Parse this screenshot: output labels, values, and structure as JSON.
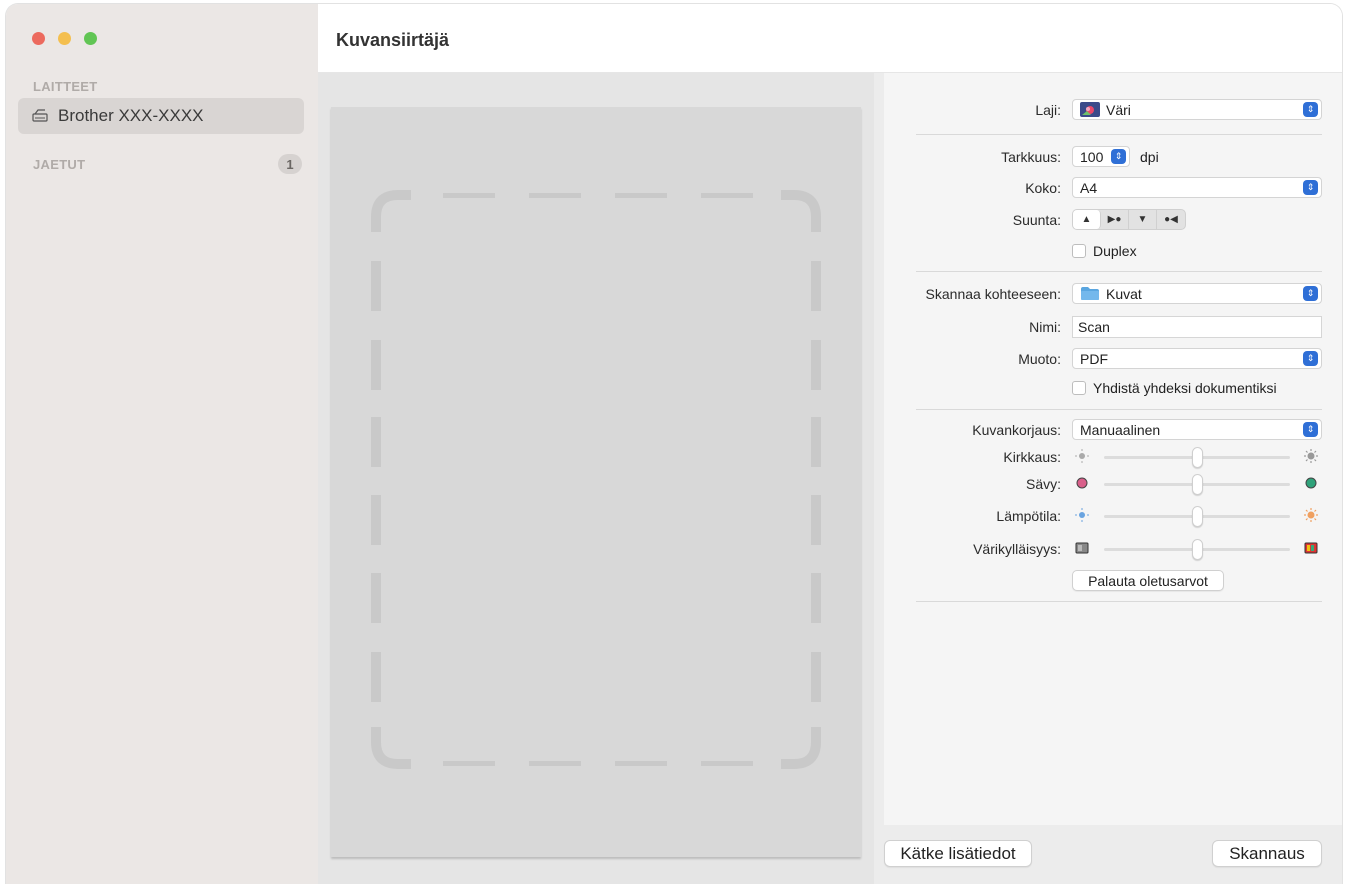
{
  "window": {
    "title": "Kuvansiirtäjä"
  },
  "traffic_lights": {
    "close": "#ec6a5e",
    "minimize": "#f4bf4f",
    "zoom": "#61c554"
  },
  "sidebar": {
    "devices_header": "LAITTEET",
    "device_name": "Brother XXX-XXXX",
    "device_icon": "scanner-icon",
    "shared_header": "JAETUT",
    "shared_count": "1"
  },
  "settings": {
    "kind": {
      "label": "Laji:",
      "value": "Väri",
      "icon": "color-photo-icon"
    },
    "resolution": {
      "label": "Tarkkuus:",
      "value": "100",
      "unit": "dpi"
    },
    "size": {
      "label": "Koko:",
      "value": "A4"
    },
    "orientation": {
      "label": "Suunta:",
      "icons": [
        "portrait-icon",
        "rotate-right-icon",
        "upside-down-icon",
        "rotate-left-icon"
      ]
    },
    "duplex": {
      "label": "Duplex",
      "checked": false
    },
    "scan_to": {
      "label": "Skannaa kohteeseen:",
      "value": "Kuvat",
      "icon": "folder-icon"
    },
    "name": {
      "label": "Nimi:",
      "value": "Scan"
    },
    "format": {
      "label": "Muoto:",
      "value": "PDF"
    },
    "combine": {
      "label": "Yhdistä yhdeksi dokumentiksi",
      "checked": false
    },
    "correction": {
      "label": "Kuvankorjaus:",
      "value": "Manuaalinen"
    },
    "brightness": {
      "label": "Kirkkaus:",
      "level": 0.5
    },
    "tint": {
      "label": "Sävy:",
      "level": 0.5
    },
    "temperature": {
      "label": "Lämpötila:",
      "level": 0.5
    },
    "saturation": {
      "label": "Värikylläisyys:",
      "level": 0.5
    },
    "reset_button": "Palauta oletusarvot"
  },
  "footer": {
    "hide_details_button": "Kätke lisätiedot",
    "scan_button": "Skannaus"
  },
  "accent_color": "#2f6fd6"
}
